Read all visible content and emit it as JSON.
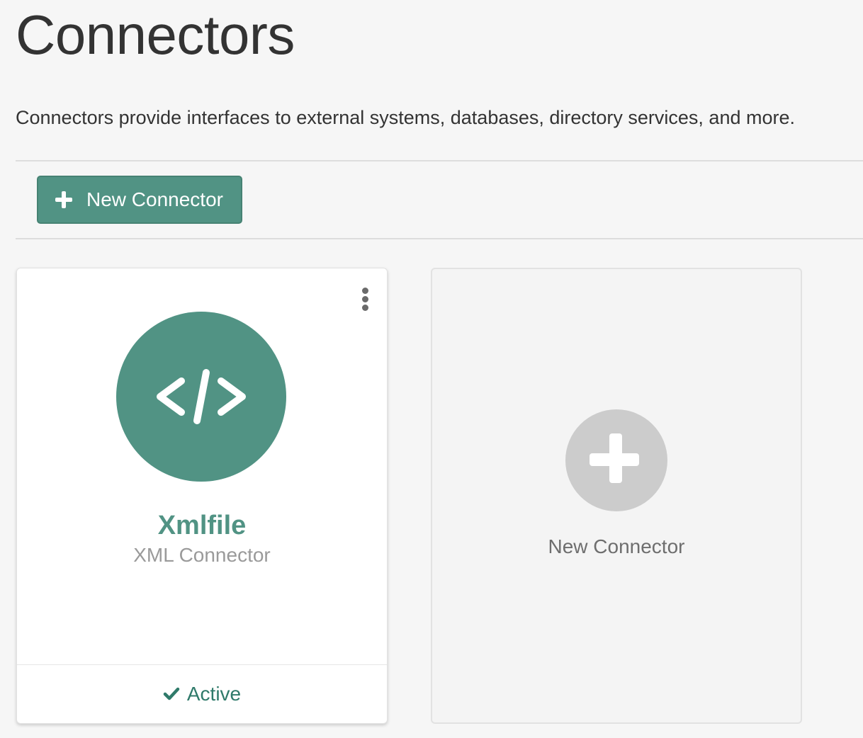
{
  "header": {
    "title": "Connectors",
    "description": "Connectors provide interfaces to external systems, databases, directory services, and more."
  },
  "toolbar": {
    "new_connector_label": "New Connector",
    "new_connector_icon": "plus-icon"
  },
  "connectors": [
    {
      "name": "Xmlfile",
      "type": "XML Connector",
      "icon": "code-icon",
      "status": "Active",
      "status_icon": "checkmark-icon",
      "menu_icon": "vertical-ellipsis-icon"
    }
  ],
  "new_card": {
    "label": "New Connector",
    "icon": "plus-circle-icon"
  },
  "colors": {
    "accent": "#519384",
    "status_active": "#2f7a6a",
    "muted_text": "#9a9a9a",
    "placeholder_circle": "#cccccc",
    "background": "#f6f6f6"
  }
}
